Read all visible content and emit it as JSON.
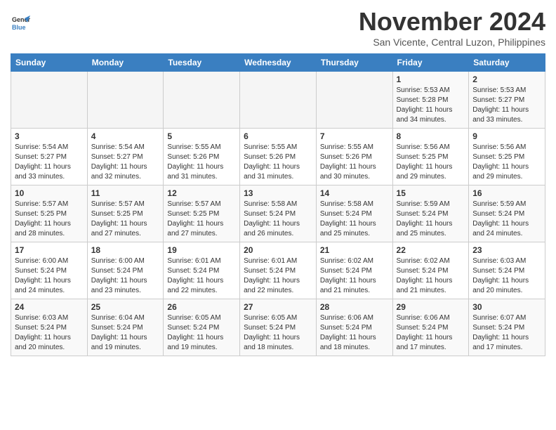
{
  "header": {
    "logo_line1": "General",
    "logo_line2": "Blue",
    "month": "November 2024",
    "location": "San Vicente, Central Luzon, Philippines"
  },
  "weekdays": [
    "Sunday",
    "Monday",
    "Tuesday",
    "Wednesday",
    "Thursday",
    "Friday",
    "Saturday"
  ],
  "weeks": [
    [
      {
        "day": "",
        "info": ""
      },
      {
        "day": "",
        "info": ""
      },
      {
        "day": "",
        "info": ""
      },
      {
        "day": "",
        "info": ""
      },
      {
        "day": "",
        "info": ""
      },
      {
        "day": "1",
        "info": "Sunrise: 5:53 AM\nSunset: 5:28 PM\nDaylight: 11 hours\nand 34 minutes."
      },
      {
        "day": "2",
        "info": "Sunrise: 5:53 AM\nSunset: 5:27 PM\nDaylight: 11 hours\nand 33 minutes."
      }
    ],
    [
      {
        "day": "3",
        "info": "Sunrise: 5:54 AM\nSunset: 5:27 PM\nDaylight: 11 hours\nand 33 minutes."
      },
      {
        "day": "4",
        "info": "Sunrise: 5:54 AM\nSunset: 5:27 PM\nDaylight: 11 hours\nand 32 minutes."
      },
      {
        "day": "5",
        "info": "Sunrise: 5:55 AM\nSunset: 5:26 PM\nDaylight: 11 hours\nand 31 minutes."
      },
      {
        "day": "6",
        "info": "Sunrise: 5:55 AM\nSunset: 5:26 PM\nDaylight: 11 hours\nand 31 minutes."
      },
      {
        "day": "7",
        "info": "Sunrise: 5:55 AM\nSunset: 5:26 PM\nDaylight: 11 hours\nand 30 minutes."
      },
      {
        "day": "8",
        "info": "Sunrise: 5:56 AM\nSunset: 5:25 PM\nDaylight: 11 hours\nand 29 minutes."
      },
      {
        "day": "9",
        "info": "Sunrise: 5:56 AM\nSunset: 5:25 PM\nDaylight: 11 hours\nand 29 minutes."
      }
    ],
    [
      {
        "day": "10",
        "info": "Sunrise: 5:57 AM\nSunset: 5:25 PM\nDaylight: 11 hours\nand 28 minutes."
      },
      {
        "day": "11",
        "info": "Sunrise: 5:57 AM\nSunset: 5:25 PM\nDaylight: 11 hours\nand 27 minutes."
      },
      {
        "day": "12",
        "info": "Sunrise: 5:57 AM\nSunset: 5:25 PM\nDaylight: 11 hours\nand 27 minutes."
      },
      {
        "day": "13",
        "info": "Sunrise: 5:58 AM\nSunset: 5:24 PM\nDaylight: 11 hours\nand 26 minutes."
      },
      {
        "day": "14",
        "info": "Sunrise: 5:58 AM\nSunset: 5:24 PM\nDaylight: 11 hours\nand 25 minutes."
      },
      {
        "day": "15",
        "info": "Sunrise: 5:59 AM\nSunset: 5:24 PM\nDaylight: 11 hours\nand 25 minutes."
      },
      {
        "day": "16",
        "info": "Sunrise: 5:59 AM\nSunset: 5:24 PM\nDaylight: 11 hours\nand 24 minutes."
      }
    ],
    [
      {
        "day": "17",
        "info": "Sunrise: 6:00 AM\nSunset: 5:24 PM\nDaylight: 11 hours\nand 24 minutes."
      },
      {
        "day": "18",
        "info": "Sunrise: 6:00 AM\nSunset: 5:24 PM\nDaylight: 11 hours\nand 23 minutes."
      },
      {
        "day": "19",
        "info": "Sunrise: 6:01 AM\nSunset: 5:24 PM\nDaylight: 11 hours\nand 22 minutes."
      },
      {
        "day": "20",
        "info": "Sunrise: 6:01 AM\nSunset: 5:24 PM\nDaylight: 11 hours\nand 22 minutes."
      },
      {
        "day": "21",
        "info": "Sunrise: 6:02 AM\nSunset: 5:24 PM\nDaylight: 11 hours\nand 21 minutes."
      },
      {
        "day": "22",
        "info": "Sunrise: 6:02 AM\nSunset: 5:24 PM\nDaylight: 11 hours\nand 21 minutes."
      },
      {
        "day": "23",
        "info": "Sunrise: 6:03 AM\nSunset: 5:24 PM\nDaylight: 11 hours\nand 20 minutes."
      }
    ],
    [
      {
        "day": "24",
        "info": "Sunrise: 6:03 AM\nSunset: 5:24 PM\nDaylight: 11 hours\nand 20 minutes."
      },
      {
        "day": "25",
        "info": "Sunrise: 6:04 AM\nSunset: 5:24 PM\nDaylight: 11 hours\nand 19 minutes."
      },
      {
        "day": "26",
        "info": "Sunrise: 6:05 AM\nSunset: 5:24 PM\nDaylight: 11 hours\nand 19 minutes."
      },
      {
        "day": "27",
        "info": "Sunrise: 6:05 AM\nSunset: 5:24 PM\nDaylight: 11 hours\nand 18 minutes."
      },
      {
        "day": "28",
        "info": "Sunrise: 6:06 AM\nSunset: 5:24 PM\nDaylight: 11 hours\nand 18 minutes."
      },
      {
        "day": "29",
        "info": "Sunrise: 6:06 AM\nSunset: 5:24 PM\nDaylight: 11 hours\nand 17 minutes."
      },
      {
        "day": "30",
        "info": "Sunrise: 6:07 AM\nSunset: 5:24 PM\nDaylight: 11 hours\nand 17 minutes."
      }
    ]
  ]
}
